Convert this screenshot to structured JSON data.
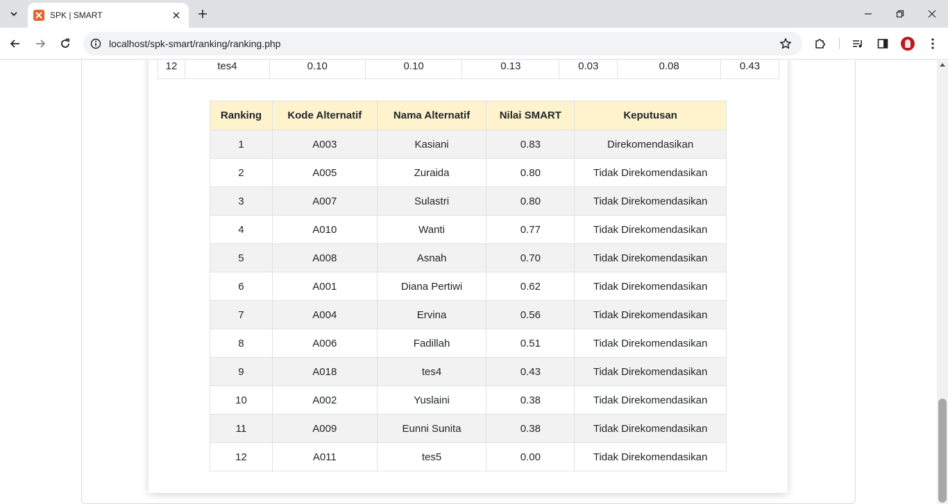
{
  "browser": {
    "tab_title": "SPK | SMART",
    "url": "localhost/spk-smart/ranking/ranking.php"
  },
  "top_table_row": [
    "12",
    "tes4",
    "0.10",
    "0.10",
    "0.13",
    "0.03",
    "0.08",
    "0.43"
  ],
  "ranking_table": {
    "headers": [
      "Ranking",
      "Kode Alternatif",
      "Nama Alternatif",
      "Nilai SMART",
      "Keputusan"
    ],
    "rows": [
      [
        "1",
        "A003",
        "Kasiani",
        "0.83",
        "Direkomendasikan"
      ],
      [
        "2",
        "A005",
        "Zuraida",
        "0.80",
        "Tidak Direkomendasikan"
      ],
      [
        "3",
        "A007",
        "Sulastri",
        "0.80",
        "Tidak Direkomendasikan"
      ],
      [
        "4",
        "A010",
        "Wanti",
        "0.77",
        "Tidak Direkomendasikan"
      ],
      [
        "5",
        "A008",
        "Asnah",
        "0.70",
        "Tidak Direkomendasikan"
      ],
      [
        "6",
        "A001",
        "Diana Pertiwi",
        "0.62",
        "Tidak Direkomendasikan"
      ],
      [
        "7",
        "A004",
        "Ervina",
        "0.56",
        "Tidak Direkomendasikan"
      ],
      [
        "8",
        "A006",
        "Fadillah",
        "0.51",
        "Tidak Direkomendasikan"
      ],
      [
        "9",
        "A018",
        "tes4",
        "0.43",
        "Tidak Direkomendasikan"
      ],
      [
        "10",
        "A002",
        "Yuslaini",
        "0.38",
        "Tidak Direkomendasikan"
      ],
      [
        "11",
        "A009",
        "Eunni Sunita",
        "0.38",
        "Tidak Direkomendasikan"
      ],
      [
        "12",
        "A011",
        "tes5",
        "0.00",
        "Tidak Direkomendasikan"
      ]
    ]
  },
  "colors": {
    "header_bg": "#fff3cd",
    "stripe_bg": "#f2f2f2",
    "favicon": "#e8622c"
  }
}
